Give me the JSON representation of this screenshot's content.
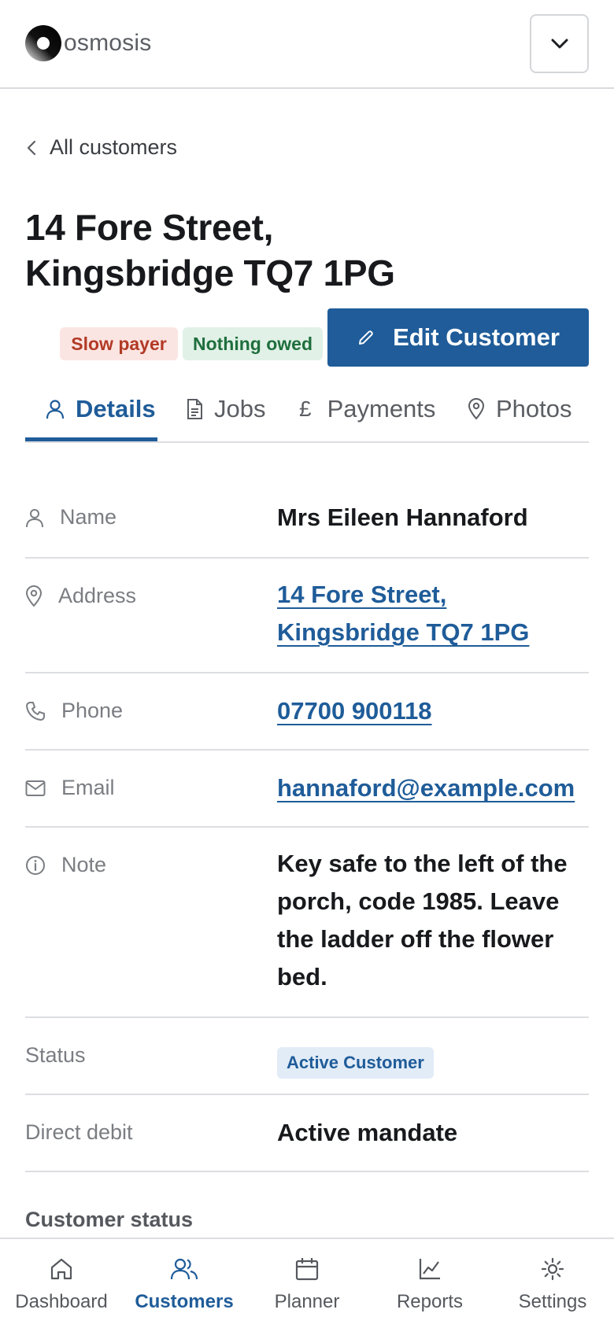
{
  "header": {
    "brand": "osmosis",
    "menu_icon": "chevron-down-icon"
  },
  "breadcrumb": {
    "back_label": "All customers"
  },
  "customer": {
    "title_line1": "14 Fore Street,",
    "title_line2": "Kingsbridge TQ7 1PG"
  },
  "badges": {
    "slow_payer": "Slow payer",
    "nothing_owed": "Nothing owed"
  },
  "actions": {
    "edit_label": "Edit Customer"
  },
  "tabs": [
    {
      "label": "Details",
      "icon": "person-icon",
      "active": true
    },
    {
      "label": "Jobs",
      "icon": "document-icon",
      "active": false
    },
    {
      "label": "Payments",
      "icon": "pound-icon",
      "active": false
    },
    {
      "label": "Photos",
      "icon": "location-pin-icon",
      "active": false
    }
  ],
  "details": {
    "name": {
      "label": "Name",
      "value": "Mrs Eileen Hannaford"
    },
    "address": {
      "label": "Address",
      "line1": "14 Fore Street,",
      "line2": "Kingsbridge TQ7 1PG"
    },
    "phone": {
      "label": "Phone",
      "value": "07700 900118"
    },
    "email": {
      "label": "Email",
      "value": "hannaford@example.com"
    },
    "note": {
      "label": "Note",
      "value": "Key safe to the left of the porch, code 1985. Leave the ladder off the flower bed."
    },
    "status": {
      "label": "Status",
      "value": "Active Customer"
    },
    "direct_debit": {
      "label": "Direct debit",
      "value": "Active mandate"
    }
  },
  "section": {
    "customer_status": "Customer status"
  },
  "bottom_nav": [
    {
      "label": "Dashboard",
      "icon": "home-icon",
      "active": false
    },
    {
      "label": "Customers",
      "icon": "users-icon",
      "active": true
    },
    {
      "label": "Planner",
      "icon": "calendar-icon",
      "active": false
    },
    {
      "label": "Reports",
      "icon": "chart-icon",
      "active": false
    },
    {
      "label": "Settings",
      "icon": "gear-icon",
      "active": false
    }
  ],
  "colors": {
    "accent": "#1f5c99",
    "slow_payer_bg": "#fbe5e2",
    "slow_payer_text": "#b23a25",
    "nothing_owed_bg": "#e1f1e7",
    "nothing_owed_text": "#1f6e3d",
    "status_pill_bg": "#e2ecf7"
  }
}
